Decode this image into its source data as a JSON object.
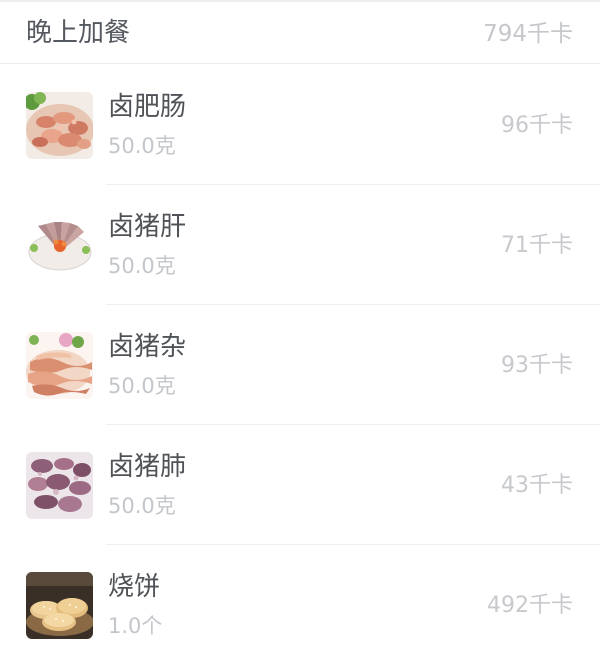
{
  "meal": {
    "title": "晚上加餐",
    "total_calories": "794千卡"
  },
  "foods": [
    {
      "name": "卤肥肠",
      "amount": "50.0克",
      "calories": "96千卡",
      "icon": "braised-intestine-photo"
    },
    {
      "name": "卤猪肝",
      "amount": "50.0克",
      "calories": "71千卡",
      "icon": "braised-pork-liver-photo"
    },
    {
      "name": "卤猪杂",
      "amount": "50.0克",
      "calories": "93千卡",
      "icon": "braised-pork-offal-photo"
    },
    {
      "name": "卤猪肺",
      "amount": "50.0克",
      "calories": "43千卡",
      "icon": "braised-pork-lung-photo"
    },
    {
      "name": "烧饼",
      "amount": "1.0个",
      "calories": "492千卡",
      "icon": "sesame-flatbread-photo"
    }
  ]
}
